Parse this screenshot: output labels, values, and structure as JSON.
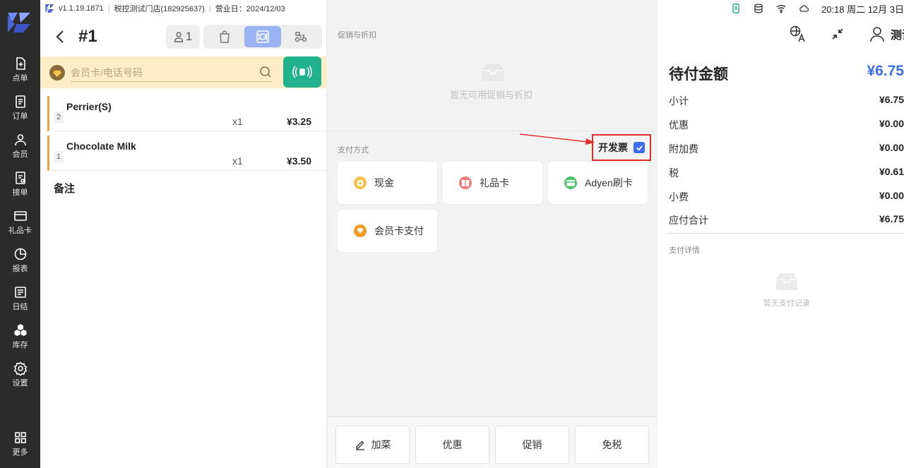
{
  "app": {
    "version": "v1.1.19.1871",
    "store": "税控测试门店(182925637)",
    "business_day": "营业日：2024/12/03"
  },
  "nav": [
    {
      "label": "点单",
      "icon": "add-order-icon"
    },
    {
      "label": "订单",
      "icon": "order-list-icon"
    },
    {
      "label": "会员",
      "icon": "member-icon"
    },
    {
      "label": "接单",
      "icon": "accept-order-icon"
    },
    {
      "label": "礼品卡",
      "icon": "gift-card-icon"
    },
    {
      "label": "报表",
      "icon": "report-icon"
    },
    {
      "label": "日结",
      "icon": "daily-close-icon"
    },
    {
      "label": "库存",
      "icon": "inventory-icon"
    },
    {
      "label": "设置",
      "icon": "settings-icon"
    },
    {
      "label": "更多",
      "icon": "more-icon"
    }
  ],
  "order": {
    "number": "#1",
    "guests": "1",
    "modes": [
      {
        "icon": "takeout-bag-icon",
        "active": false
      },
      {
        "icon": "dine-in-icon",
        "active": true
      },
      {
        "icon": "delivery-scooter-icon",
        "active": false
      }
    ],
    "member_placeholder": "会员卡/电话号码",
    "items": [
      {
        "index": "2",
        "name": "Perrier(S)",
        "qty": "x1",
        "price": "¥3.25"
      },
      {
        "index": "1",
        "name": "Chocolate Milk",
        "qty": "x1",
        "price": "¥3.50"
      }
    ],
    "remark_label": "备注"
  },
  "payment": {
    "promo_title": "促销与折扣",
    "promo_empty": "暂无可用促销与折扣",
    "method_title": "支付方式",
    "invoice_label": "开发票",
    "invoice_checked": true,
    "methods": [
      {
        "label": "现金",
        "icon": "cash-icon",
        "color": "#f3c14b"
      },
      {
        "label": "礼品卡",
        "icon": "gift-icon",
        "color": "#f07b7b"
      },
      {
        "label": "Adyen刷卡",
        "icon": "card-icon",
        "color": "#4cc36a"
      },
      {
        "label": "会员卡支付",
        "icon": "member-pay-icon",
        "color": "#f39a22"
      }
    ],
    "actions": [
      "加菜",
      "优惠",
      "促销",
      "免税"
    ]
  },
  "status": {
    "time": "20:18 周二 12月 3日"
  },
  "summary": {
    "user": "测试",
    "due_label": "待付金额",
    "due_value": "¥6.75",
    "rows": [
      {
        "label": "小计",
        "value": "¥6.75"
      },
      {
        "label": "优惠",
        "value": "¥0.00"
      },
      {
        "label": "附加费",
        "value": "¥0.00"
      },
      {
        "label": "税",
        "value": "¥0.61"
      },
      {
        "label": "小费",
        "value": "¥0.00"
      },
      {
        "label": "应付合计",
        "value": "¥6.75"
      }
    ],
    "detail_title": "支付详情",
    "detail_empty": "暂无支付记录"
  },
  "colors": {
    "accent": "#3c6df0",
    "success": "#22b28b",
    "highlight": "#e32b2b",
    "item_marker": "#f5a23c"
  }
}
